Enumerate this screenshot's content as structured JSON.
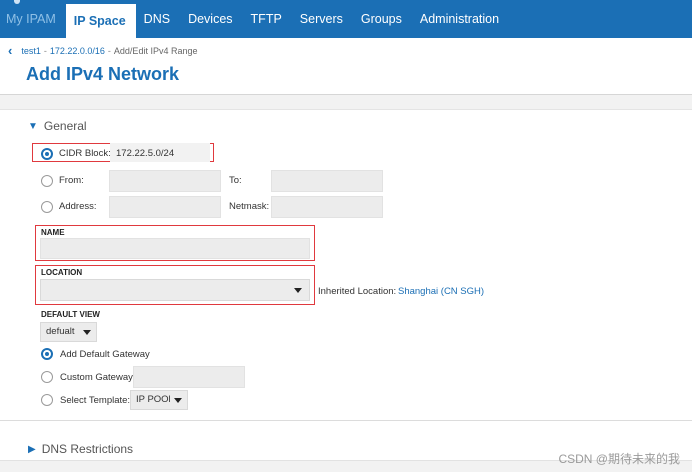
{
  "nav": {
    "items": [
      {
        "label": "My IPAM",
        "state": "inactive-dim"
      },
      {
        "label": "IP Space",
        "state": "active"
      },
      {
        "label": "DNS"
      },
      {
        "label": "Devices"
      },
      {
        "label": "TFTP"
      },
      {
        "label": "Servers"
      },
      {
        "label": "Groups"
      },
      {
        "label": "Administration"
      }
    ]
  },
  "breadcrumb": {
    "back_icon": "chevron-left-icon",
    "items": [
      "test1",
      "172.22.0.0/16",
      "Add/Edit IPv4 Range"
    ],
    "separator": "-"
  },
  "page_title": "Add IPv4 Network",
  "general": {
    "section_label": "General",
    "cidr": {
      "label": "CIDR Block:",
      "value": "172.22.5.0/24"
    },
    "range": {
      "from_label": "From:",
      "to_label": "To:"
    },
    "address": {
      "label": "Address:",
      "netmask_label": "Netmask:"
    },
    "name": {
      "label": "NAME",
      "value": ""
    },
    "location": {
      "label": "LOCATION",
      "inherited_label": "Inherited Location:",
      "inherited_value": "Shanghai (CN SGH)"
    },
    "default_view": {
      "label": "DEFAULT VIEW",
      "value": "defualt"
    },
    "gateway": {
      "add_default_label": "Add Default Gateway",
      "custom_label": "Custom Gateway:",
      "template_label": "Select Template:",
      "template_value": "IP POOl"
    }
  },
  "dns_restrictions": {
    "section_label": "DNS Restrictions"
  },
  "watermark": "CSDN @期待未来的我",
  "colors": {
    "accent": "#1b6fb5",
    "highlight_box": "#e0393e",
    "field_bg": "#ececec"
  }
}
